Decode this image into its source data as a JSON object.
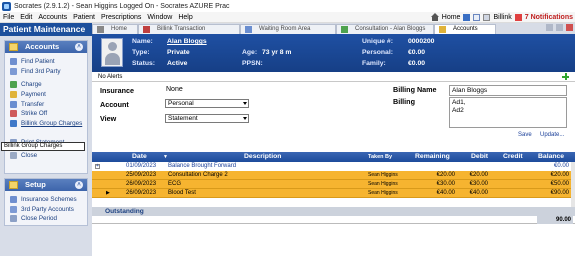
{
  "window": {
    "title": "Socrates (2.9.1.2) - Sean Higgins Logged On - Socrates AZURE Prac"
  },
  "menu": {
    "items": [
      "File",
      "Edit",
      "Accounts",
      "Patient",
      "Prescriptions",
      "Window",
      "Help"
    ],
    "home_label": "Home",
    "billink_label": "Billink",
    "notifications_label": "7 Notifications"
  },
  "sidebar": {
    "title": "Patient Maintenance",
    "accounts_panel": {
      "title": "Accounts",
      "items": [
        "Find Patient",
        "Find 3rd Party",
        "Charge",
        "Payment",
        "Transfer",
        "Strike Off",
        "Billink Group Charges",
        "Print Statement",
        "Close"
      ]
    },
    "tooltip": "Billink Group Charges",
    "setup_panel": {
      "title": "Setup",
      "items": [
        "Insurance Schemes",
        "3rd Party Accounts",
        "Close Period"
      ]
    },
    "colors": {
      "header": "#1c4f9c",
      "panel_header": "#3d65ab"
    }
  },
  "tabs": [
    {
      "label": "Home",
      "active": false
    },
    {
      "label": "Billink Transaction Management",
      "active": false
    },
    {
      "label": "Waiting Room Area",
      "active": false
    },
    {
      "label": "Consultation - Alan Bloggs",
      "active": false
    },
    {
      "label": "Accounts",
      "active": true
    }
  ],
  "patient": {
    "name_label": "Name:",
    "name": "Alan Bloggs",
    "type_label": "Type:",
    "type": "Private",
    "status_label": "Status:",
    "status": "Active",
    "age_label": "Age:",
    "age": "73 yr 8 m",
    "ppsn_label": "PPSN:",
    "ppsn": "",
    "unique_label": "Unique #:",
    "unique": "0000200",
    "personal_label": "Personal:",
    "personal": "€0.00",
    "family_label": "Family:",
    "family": "€0.00"
  },
  "alerts": {
    "text": "No Alerts"
  },
  "form": {
    "insurance_label": "Insurance",
    "insurance_value": "None",
    "account_label": "Account",
    "account_value": "Personal",
    "view_label": "View",
    "view_value": "Statement",
    "billing_name_label": "Billing Name",
    "billing_name": "Alan Bloggs",
    "billing_label": "Billing",
    "billing_line1": "Ad1,",
    "billing_line2": "Ad2",
    "save_label": "Save",
    "update_label": "Update..."
  },
  "table": {
    "columns": [
      "Date",
      "Description",
      "Taken By",
      "Remaining",
      "Debit",
      "Credit",
      "Balance"
    ],
    "rows": [
      {
        "date": "01/09/2023",
        "description": "Balance Brought Forward",
        "taken_by": "",
        "remaining": "",
        "debit": "",
        "credit": "",
        "balance": "€0.00",
        "style": "white"
      },
      {
        "date": "25/09/2023",
        "description": "Consultation Charge 2",
        "taken_by": "Sean Higgins",
        "remaining": "€20.00",
        "debit": "€20.00",
        "credit": "",
        "balance": "€20.00",
        "style": "orange"
      },
      {
        "date": "26/09/2023",
        "description": "ECG",
        "taken_by": "Sean Higgins",
        "remaining": "€30.00",
        "debit": "€30.00",
        "credit": "",
        "balance": "€50.00",
        "style": "orange"
      },
      {
        "date": "26/09/2023",
        "description": "Blood Test",
        "taken_by": "Sean Higgins",
        "remaining": "€40.00",
        "debit": "€40.00",
        "credit": "",
        "balance": "€90.00",
        "style": "orange"
      }
    ],
    "outstanding_label": "Outstanding",
    "total": "90.00",
    "colors": {
      "header": "#1d4b9b",
      "charge_row": "#f6b430"
    }
  }
}
